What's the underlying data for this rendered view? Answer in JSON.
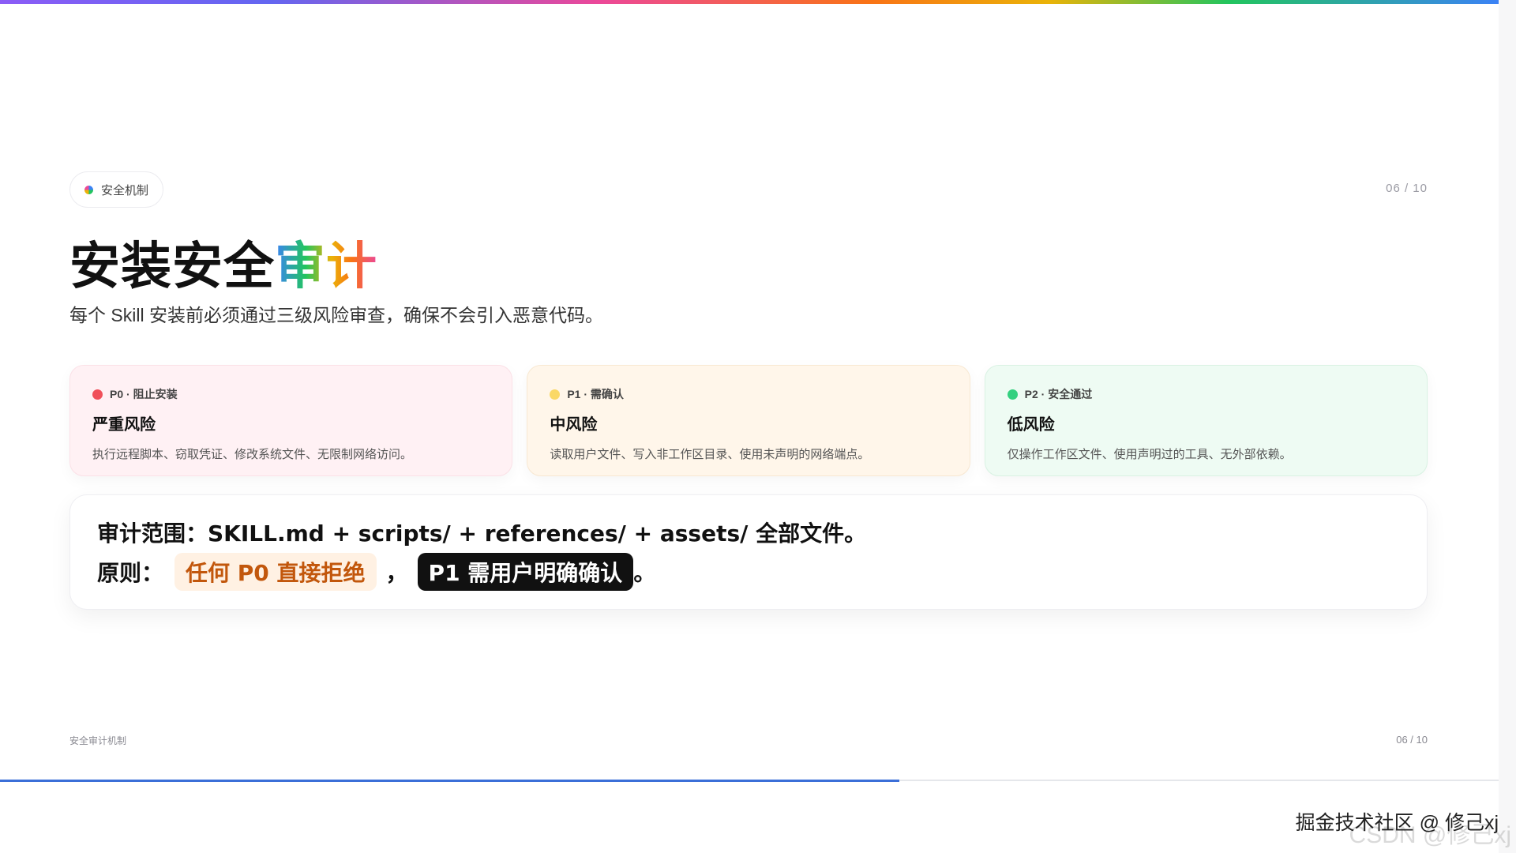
{
  "badge": {
    "label": "安全机制",
    "icon": "multicolor-dot-icon"
  },
  "pager_top": "06 / 10",
  "title": {
    "main": "安装安全",
    "accent": "审计"
  },
  "subtitle": "每个 Skill 安装前必须通过三级风险审查，确保不会引入恶意代码。",
  "risk_cards": [
    {
      "tag": "P0 · 阻止安装",
      "title": "严重风险",
      "desc": "执行远程脚本、窃取凭证、修改系统文件、无限制网络访问。",
      "dot_color": "#f0505a"
    },
    {
      "tag": "P1 · 需确认",
      "title": "中风险",
      "desc": "读取用户文件、写入非工作区目录、使用未声明的网络端点。",
      "dot_color": "#fad866"
    },
    {
      "tag": "P2 · 安全通过",
      "title": "低风险",
      "desc": "仅操作工作区文件、使用声明过的工具、无外部依赖。",
      "dot_color": "#34d07f"
    }
  ],
  "audit": {
    "scope_line": "审计范围：SKILL.md + scripts/ + references/ + assets/ 全部文件。",
    "principle_label": "原则：",
    "p0_rule": "任何 P0 直接拒绝",
    "separator": "，",
    "p1_rule": "P1 需用户明确确认",
    "end": "。"
  },
  "footer": {
    "left": "安全审计机制",
    "right": "06 / 10"
  },
  "progress": {
    "fraction": 0.6
  },
  "watermark": {
    "front": "掘金技术社区 @ 修己xj",
    "back": "CSDN @修己xj"
  }
}
